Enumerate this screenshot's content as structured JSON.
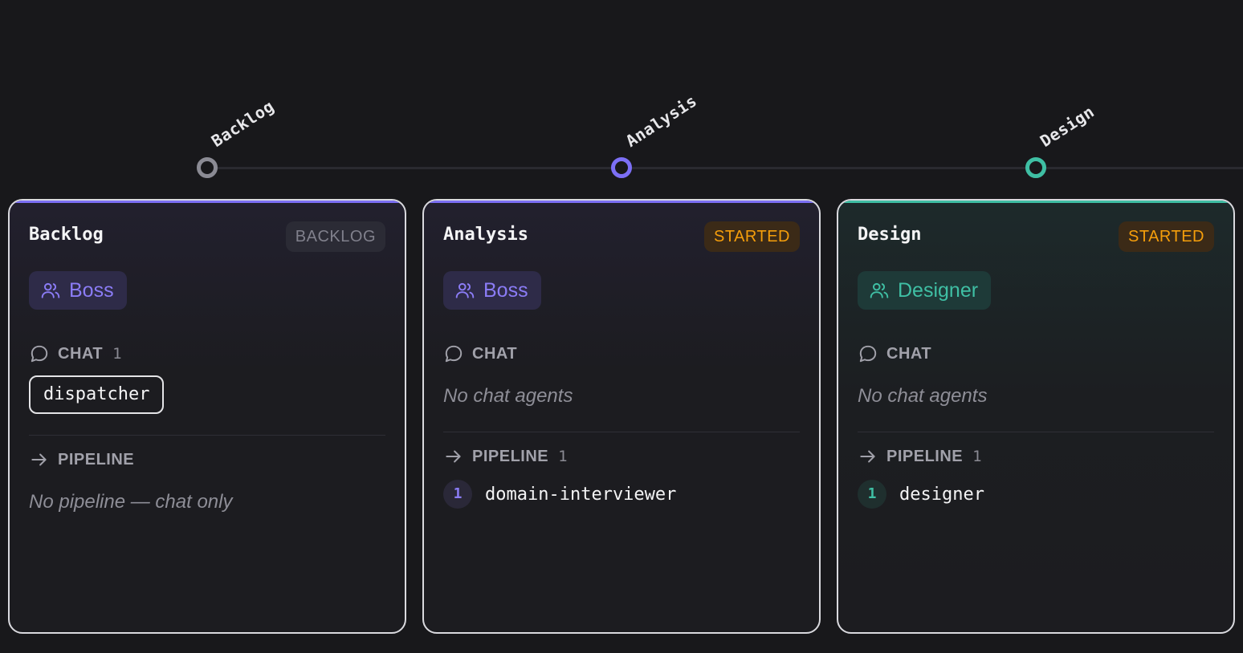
{
  "colors": {
    "background": "#18181b",
    "accent_purple": "#8b7cf6",
    "accent_teal": "#3fbfa4",
    "backlog_node": "#8b8b94",
    "started_badge": "#f59e0b"
  },
  "timeline": {
    "nodes": [
      {
        "label": "Backlog",
        "color": "#8b8b94"
      },
      {
        "label": "Analysis",
        "color": "#7c6ff5"
      },
      {
        "label": "Design",
        "color": "#3fbfa4"
      }
    ]
  },
  "cards": [
    {
      "title": "Backlog",
      "status": "BACKLOG",
      "role_icon": "users-icon",
      "role": "Boss",
      "chat": {
        "icon": "chat-bubble-icon",
        "label": "CHAT",
        "count": "1",
        "agents": [
          "dispatcher"
        ],
        "empty_text": ""
      },
      "pipeline": {
        "icon": "arrow-right-icon",
        "label": "PIPELINE",
        "count": "",
        "steps": [],
        "empty_text": "No pipeline — chat only"
      }
    },
    {
      "title": "Analysis",
      "status": "STARTED",
      "role_icon": "users-icon",
      "role": "Boss",
      "chat": {
        "icon": "chat-bubble-icon",
        "label": "CHAT",
        "count": "",
        "agents": [],
        "empty_text": "No chat agents"
      },
      "pipeline": {
        "icon": "arrow-right-icon",
        "label": "PIPELINE",
        "count": "1",
        "steps": [
          {
            "num": "1",
            "name": "domain-interviewer"
          }
        ],
        "empty_text": ""
      }
    },
    {
      "title": "Design",
      "status": "STARTED",
      "role_icon": "users-icon",
      "role": "Designer",
      "chat": {
        "icon": "chat-bubble-icon",
        "label": "CHAT",
        "count": "",
        "agents": [],
        "empty_text": "No chat agents"
      },
      "pipeline": {
        "icon": "arrow-right-icon",
        "label": "PIPELINE",
        "count": "1",
        "steps": [
          {
            "num": "1",
            "name": "designer"
          }
        ],
        "empty_text": ""
      }
    }
  ]
}
